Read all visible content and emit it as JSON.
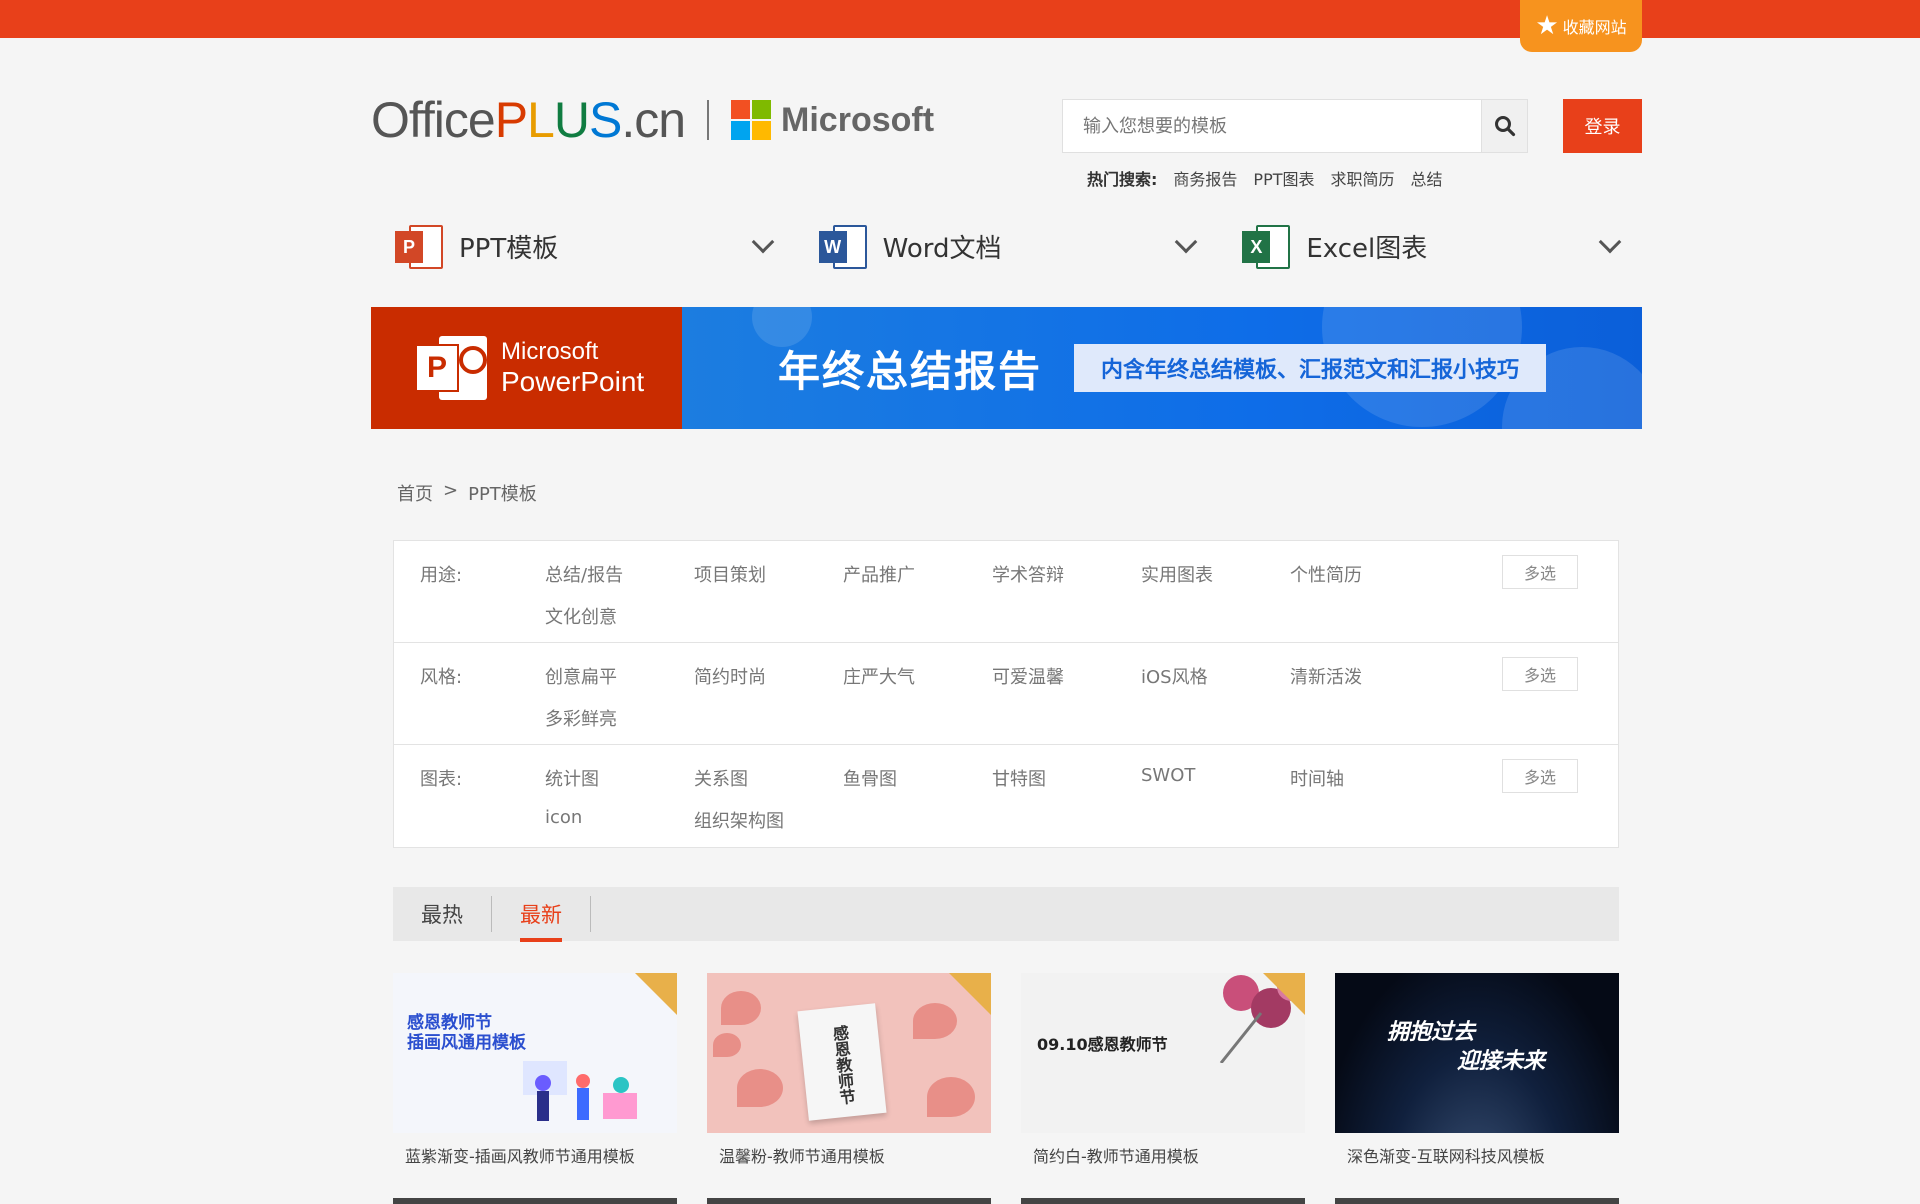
{
  "top": {
    "favorite_label": "收藏网站"
  },
  "logo": {
    "office": "Office",
    "plus_p": "P",
    "plus_l": "L",
    "plus_u": "U",
    "plus_s": "S",
    "cn": ".cn",
    "microsoft": "Microsoft"
  },
  "search": {
    "placeholder": "输入您想要的模板",
    "login_label": "登录"
  },
  "hot_search": {
    "label": "热门搜索:",
    "items": [
      "商务报告",
      "PPT图表",
      "求职简历",
      "总结"
    ]
  },
  "nav": [
    {
      "label": "PPT模板",
      "icon_letter": "P",
      "color": "#d24726"
    },
    {
      "label": "Word文档",
      "icon_letter": "W",
      "color": "#2b579a"
    },
    {
      "label": "Excel图表",
      "icon_letter": "X",
      "color": "#217346"
    }
  ],
  "banner": {
    "icon_letter": "P",
    "brand_line1": "Microsoft",
    "brand_line2": "PowerPoint",
    "title": "年终总结报告",
    "tag": "内含年终总结模板、汇报范文和汇报小技巧"
  },
  "breadcrumb": {
    "home": "首页",
    "sep": ">",
    "current": "PPT模板"
  },
  "filters": [
    {
      "label": "用途:",
      "options": [
        "总结/报告",
        "项目策划",
        "产品推广",
        "学术答辩",
        "实用图表",
        "个性简历",
        "文化创意"
      ],
      "multi": "多选"
    },
    {
      "label": "风格:",
      "options": [
        "创意扁平",
        "简约时尚",
        "庄严大气",
        "可爱温馨",
        "iOS风格",
        "清新活泼",
        "多彩鲜亮"
      ],
      "multi": "多选"
    },
    {
      "label": "图表:",
      "options": [
        "统计图",
        "关系图",
        "鱼骨图",
        "甘特图",
        "SWOT",
        "时间轴",
        "icon",
        "组织架构图"
      ],
      "multi": "多选"
    }
  ],
  "sort": {
    "tabs": [
      "最热",
      "最新"
    ],
    "active": "最新"
  },
  "cards": [
    {
      "title": "蓝紫渐变-插画风教师节通用模板",
      "thumb_line1": "感恩教师节",
      "thumb_line2": "插画风通用模板"
    },
    {
      "title": "温馨粉-教师节通用模板",
      "thumb_text": "感恩教师节"
    },
    {
      "title": "简约白-教师节通用模板",
      "thumb_text": "09.10感恩教师节"
    },
    {
      "title": "深色渐变-互联网科技风模板",
      "thumb_line1": "拥抱过去",
      "thumb_line2": "迎接未来"
    }
  ],
  "colors": {
    "brand": "#e8401a",
    "badge": "#e8b04a"
  }
}
